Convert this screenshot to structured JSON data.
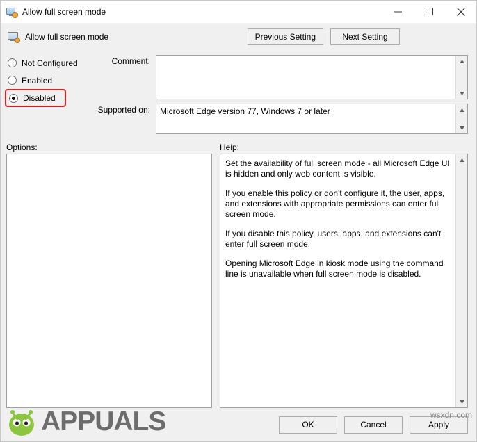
{
  "window": {
    "title": "Allow full screen mode",
    "icon": "policy-setting-icon",
    "controls": {
      "minimize": "minimize-icon",
      "maximize": "maximize-icon",
      "close": "close-icon"
    }
  },
  "header": {
    "title": "Allow full screen mode",
    "icon": "policy-setting-icon",
    "previous_setting": "Previous Setting",
    "next_setting": "Next Setting"
  },
  "state_options": [
    {
      "label": "Not Configured",
      "selected": false
    },
    {
      "label": "Enabled",
      "selected": false
    },
    {
      "label": "Disabled",
      "selected": true,
      "highlighted": true
    }
  ],
  "fields": {
    "comment_label": "Comment:",
    "comment_value": "",
    "supported_label": "Supported on:",
    "supported_value": "Microsoft Edge version 77, Windows 7 or later"
  },
  "panes": {
    "options_label": "Options:",
    "options_content": "",
    "help_label": "Help:",
    "help_paragraphs": [
      "Set the availability of full screen mode - all Microsoft Edge UI is hidden and only web content is visible.",
      "If you enable this policy or don't configure it, the user, apps, and extensions with appropriate permissions can enter full screen mode.",
      "If you disable this policy, users, apps, and extensions can't enter full screen mode.",
      "Opening Microsoft Edge in kiosk mode using the command line is unavailable when full screen mode is disabled."
    ]
  },
  "footer": {
    "ok": "OK",
    "cancel": "Cancel",
    "apply": "Apply"
  },
  "watermark": {
    "brand": "APPUALS",
    "site": "wsxdn.com"
  },
  "colors": {
    "highlight": "#e02020",
    "window_bg": "#f0f0f0",
    "field_bg": "#ffffff"
  }
}
